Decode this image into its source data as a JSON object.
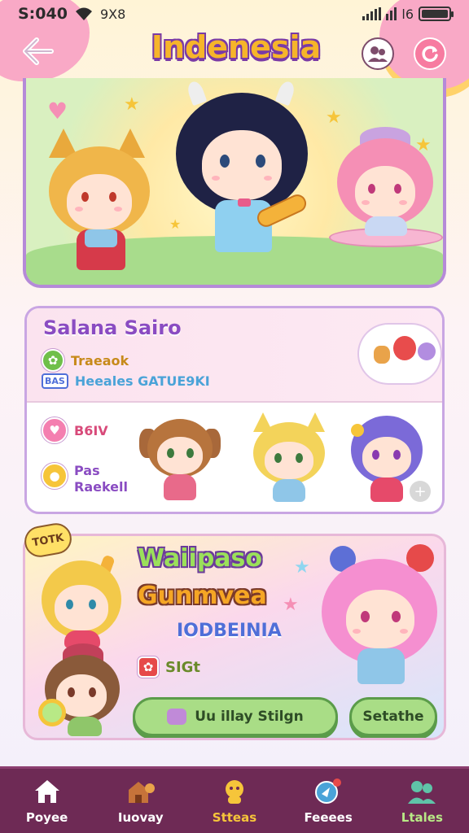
{
  "status": {
    "time": "S:040",
    "network": "9X8",
    "carrier": "l6"
  },
  "header": {
    "title": "Indenesia",
    "back_icon": "back-arrow-icon",
    "people_icon": "people-icon",
    "refresh_icon": "refresh-icon"
  },
  "card1": {
    "title": "Salana Sairo",
    "line1": "Traeaok",
    "badge": "BAS",
    "line2": "Heeales GATUE9KI",
    "stat1": "B6IV",
    "stat2_a": "Pas",
    "stat2_b": "Raekell"
  },
  "card2": {
    "bubble": "TOTK",
    "title1": "Waiipaso",
    "title2": "Gunmvea",
    "title3": "IODBEINIA",
    "tag": "SIGt",
    "primary_button": "Uu illay Stilgn",
    "secondary_button": "Setathe"
  },
  "nav": [
    {
      "label": "Poyee",
      "icon": "home-icon",
      "color": "#ffffff"
    },
    {
      "label": "Iuovay",
      "icon": "house-pet-icon",
      "color": "#ffffff"
    },
    {
      "label": "Stteas",
      "icon": "character-icon",
      "color": "#f6c53a"
    },
    {
      "label": "Feeees",
      "icon": "explore-icon",
      "color": "#ffffff"
    },
    {
      "label": "Ltales",
      "icon": "friends-icon",
      "color": "#b8e986"
    }
  ],
  "colors": {
    "accent": "#8a4cc2",
    "nav_bg": "#6e2a55",
    "active": "#f6c53a"
  }
}
